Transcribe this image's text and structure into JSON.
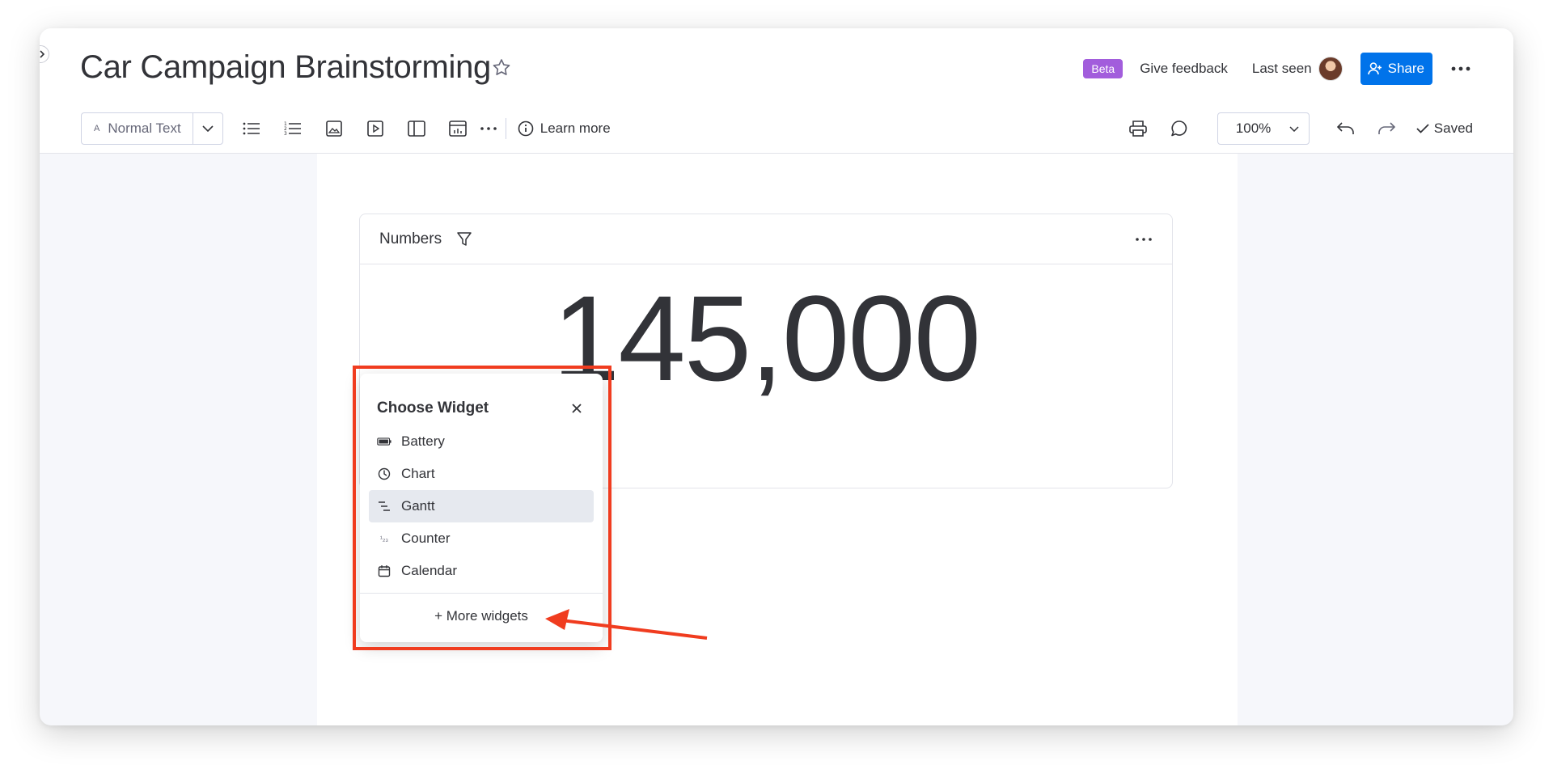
{
  "document": {
    "title": "Car Campaign Brainstorming",
    "star_icon": "star-icon"
  },
  "header": {
    "beta_badge": "Beta",
    "feedback_label": "Give feedback",
    "last_seen_label": "Last seen",
    "share_label": "Share",
    "colors": {
      "accent": "#0073ea",
      "beta": "#a25ddc"
    }
  },
  "toolbar": {
    "text_style": "Normal Text",
    "text_style_glyph": "A",
    "icons": [
      "bullet-list-icon",
      "numbered-list-icon",
      "image-icon",
      "video-icon",
      "layout-icon",
      "widget-icon",
      "more-icon"
    ],
    "learn_more_label": "Learn more",
    "zoom": "100%",
    "saved_label": "Saved"
  },
  "widget": {
    "title": "Numbers",
    "value": "145,000"
  },
  "chooser": {
    "title": "Choose Widget",
    "items": [
      {
        "label": "Battery",
        "icon": "battery-icon"
      },
      {
        "label": "Chart",
        "icon": "chart-icon"
      },
      {
        "label": "Gantt",
        "icon": "gantt-icon",
        "active": true
      },
      {
        "label": "Counter",
        "icon": "counter-icon",
        "glyph": "¹₂₃"
      },
      {
        "label": "Calendar",
        "icon": "calendar-icon"
      }
    ],
    "more_label": "+ More widgets"
  },
  "annotation": {
    "color": "#f03c1f"
  }
}
